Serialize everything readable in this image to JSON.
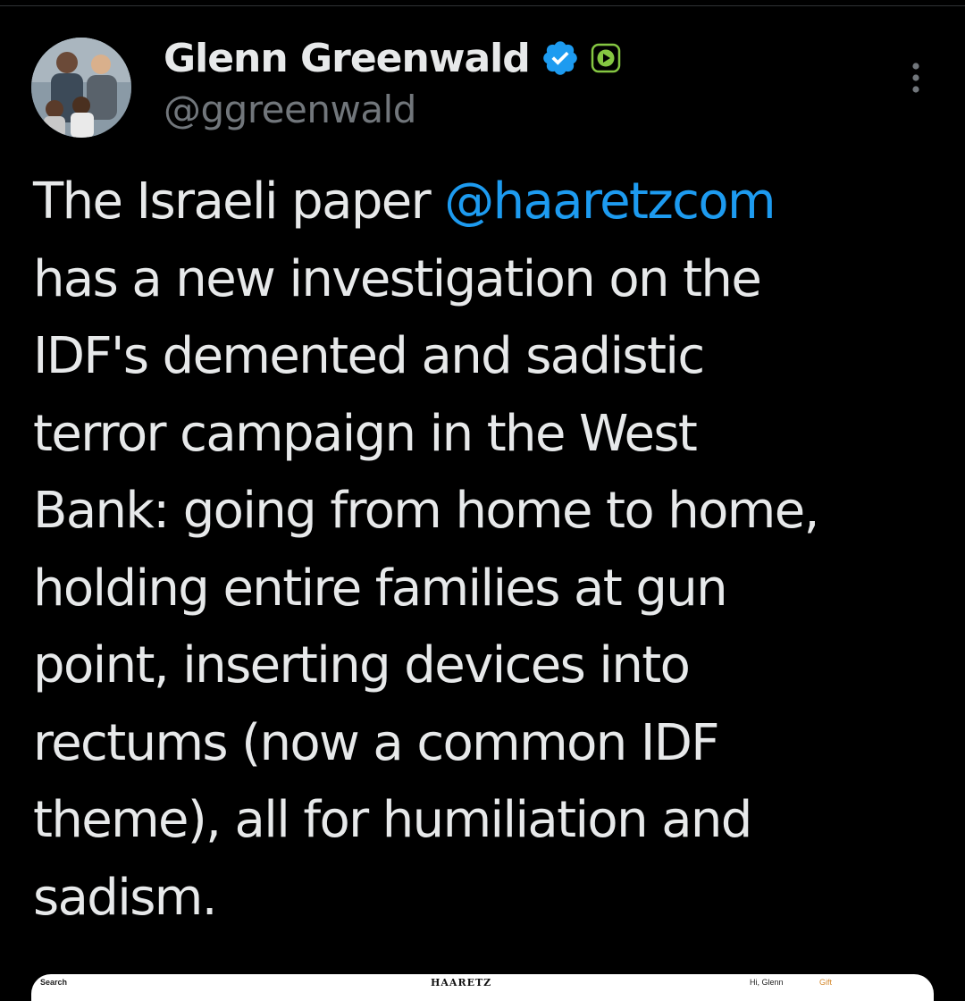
{
  "author": {
    "display_name": "Glenn Greenwald",
    "handle": "@ggreenwald",
    "verified_icon": "verified-badge-icon",
    "subscription_icon": "rumble-play-icon",
    "more_icon": "more-vertical-icon"
  },
  "tweet": {
    "lines": [
      [
        "The Israeli paper ",
        "@haaretzcom"
      ],
      [
        "has a new investigation on the"
      ],
      [
        "IDF's demented and sadistic"
      ],
      [
        "terror campaign in the West"
      ],
      [
        "Bank: going from home to home,"
      ],
      [
        "holding entire families at gun"
      ],
      [
        "point, inserting devices into"
      ],
      [
        "rectums (now a common IDF"
      ],
      [
        "theme), all for humiliation and"
      ],
      [
        "sadism."
      ]
    ]
  },
  "card": {
    "search": "Search",
    "logo": "HAARETZ",
    "greeting": "Hi, Glenn",
    "gift": "Gift"
  },
  "colors": {
    "background": "#000000",
    "text": "#e7e9ea",
    "muted": "#71767b",
    "link": "#1d9bf0",
    "verified": "#1d9bf0",
    "rumble": "#85c742"
  }
}
